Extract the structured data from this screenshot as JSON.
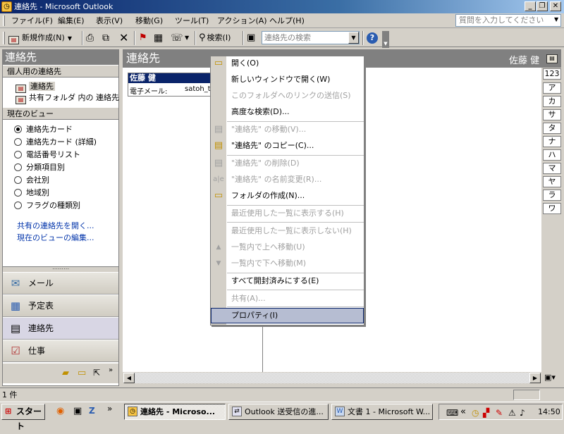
{
  "window": {
    "title": "連絡先 - Microsoft Outlook",
    "controls": [
      "_",
      "❐",
      "✕"
    ]
  },
  "menubar": {
    "items": [
      "ファイル(F)",
      "編集(E)",
      "表示(V)",
      "移動(G)",
      "ツール(T)",
      "アクション(A)",
      "ヘルプ(H)"
    ],
    "help_placeholder": "質問を入力してください"
  },
  "toolbar": {
    "new_label": "新規作成(N)",
    "search_label": "検索(I)",
    "contact_search_placeholder": "連絡先の検索"
  },
  "nav": {
    "header": "連絡先",
    "my_contacts_header": "個人用の連絡先",
    "my_contacts": [
      "連絡先",
      "共有フォルダ 内の 連絡先"
    ],
    "current_view_header": "現在のビュー",
    "views": [
      {
        "label": "連絡先カード",
        "selected": true
      },
      {
        "label": "連絡先カード (詳細)",
        "selected": false
      },
      {
        "label": "電話番号リスト",
        "selected": false
      },
      {
        "label": "分類項目別",
        "selected": false
      },
      {
        "label": "会社別",
        "selected": false
      },
      {
        "label": "地域別",
        "selected": false
      },
      {
        "label": "フラグの種類別",
        "selected": false
      }
    ],
    "links": [
      "共有の連絡先を開く...",
      "現在のビューの編集..."
    ],
    "buttons": [
      {
        "label": "メール",
        "icon": "mail-icon",
        "active": false
      },
      {
        "label": "予定表",
        "icon": "calendar-icon",
        "active": false
      },
      {
        "label": "連絡先",
        "icon": "contacts-icon",
        "active": true
      },
      {
        "label": "仕事",
        "icon": "tasks-icon",
        "active": false
      }
    ]
  },
  "content": {
    "header": "連絡先",
    "user_name": "佐藤 健",
    "card": {
      "name": "佐藤 健",
      "field_label": "電子メール:",
      "field_value": "satoh_t"
    },
    "alpha_index": [
      "123",
      "ア",
      "カ",
      "サ",
      "タ",
      "ナ",
      "ハ",
      "マ",
      "ヤ",
      "ラ",
      "ワ"
    ]
  },
  "context_menu": {
    "items": [
      {
        "label": "開く(O)",
        "disabled": false,
        "icon": "open-folder-icon"
      },
      {
        "label": "新しいウィンドウで開く(W)",
        "disabled": false,
        "icon": ""
      },
      {
        "label": "このフォルダへのリンクの送信(S)",
        "disabled": true,
        "icon": ""
      },
      {
        "label": "高度な検索(D)...",
        "disabled": false,
        "icon": ""
      },
      {
        "separator": true
      },
      {
        "label": "\"連絡先\" の移動(V)...",
        "disabled": true,
        "icon": "move-icon"
      },
      {
        "label": "\"連絡先\" のコピー(C)...",
        "disabled": false,
        "icon": "copy-folder-icon"
      },
      {
        "separator": true
      },
      {
        "label": "\"連絡先\" の削除(D)",
        "disabled": true,
        "icon": "delete-icon"
      },
      {
        "label": "\"連絡先\" の名前変更(R)...",
        "disabled": true,
        "icon": "rename-icon"
      },
      {
        "label": "フォルダの作成(N)...",
        "disabled": false,
        "icon": "new-folder-icon"
      },
      {
        "separator": true
      },
      {
        "label": "最近使用した一覧に表示する(H)",
        "disabled": true,
        "icon": ""
      },
      {
        "separator": true
      },
      {
        "label": "最近使用した一覧に表示しない(H)",
        "disabled": true,
        "icon": ""
      },
      {
        "label": "一覧内で上へ移動(U)",
        "disabled": true,
        "icon": "up-arrow-icon"
      },
      {
        "label": "一覧内で下へ移動(M)",
        "disabled": true,
        "icon": "down-arrow-icon"
      },
      {
        "separator": true
      },
      {
        "label": "すべて開封済みにする(E)",
        "disabled": false,
        "icon": ""
      },
      {
        "separator": true
      },
      {
        "label": "共有(A)...",
        "disabled": true,
        "icon": ""
      },
      {
        "separator": true
      },
      {
        "label": "プロパティ(I)",
        "disabled": false,
        "icon": "",
        "highlighted": true
      }
    ]
  },
  "statusbar": {
    "text": "1 件"
  },
  "taskbar": {
    "start_label": "スタート",
    "tasks": [
      {
        "label": "連絡先 - Microso...",
        "active": true
      },
      {
        "label": "Outlook 送受信の進...",
        "active": false
      },
      {
        "label": "文書 1 - Microsoft W...",
        "active": false
      }
    ],
    "clock": "14:50"
  }
}
